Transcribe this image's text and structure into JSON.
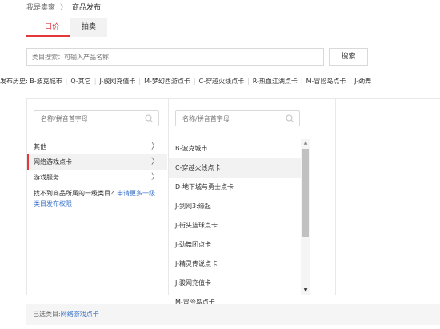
{
  "breadcrumb": {
    "root": "我是卖家",
    "separator": "〉",
    "current": "商品发布"
  },
  "tabs": [
    {
      "label": "一口价",
      "active": true
    },
    {
      "label": "拍卖",
      "active": false
    }
  ],
  "search": {
    "placeholder": "类目搜索：可输入产品名称",
    "button_label": "搜索"
  },
  "history": {
    "label": "发布历史:",
    "items": [
      "B-波克城市",
      "Q-其它",
      "J-骏网充值卡",
      "M-梦幻西游点卡",
      "C-穿越火线点卡",
      "R-热血江湖点卡",
      "M-冒险岛点卡",
      "J-劲舞"
    ]
  },
  "column1": {
    "filter_placeholder": "名称/拼音首字母",
    "items": [
      {
        "label": "其他",
        "chevron": "〉",
        "selected": false
      },
      {
        "label": "网络游戏点卡",
        "chevron": "〉",
        "selected": true
      },
      {
        "label": "游戏服务",
        "chevron": "〉",
        "selected": false
      }
    ],
    "note_text": "找不到商品所属的一级类目？",
    "note_link": "申请更多一级类目发布权限"
  },
  "column2": {
    "filter_placeholder": "名称/拼音首字母",
    "items": [
      {
        "label": "B-波克城市",
        "hover": false
      },
      {
        "label": "C-穿越火线点卡",
        "hover": true
      },
      {
        "label": "D-地下城与勇士点卡",
        "hover": false
      },
      {
        "label": "J-剑网3:缘起",
        "hover": false
      },
      {
        "label": "J-街头篮球点卡",
        "hover": false
      },
      {
        "label": "J-劲舞团点卡",
        "hover": false
      },
      {
        "label": "J-精灵传说点卡",
        "hover": false
      },
      {
        "label": "J-骏网充值卡",
        "hover": false
      },
      {
        "label": "M-冒险岛点卡",
        "hover": false
      }
    ],
    "scroll_up": "▲",
    "scroll_down": "▼"
  },
  "selected": {
    "label": "已选类目:",
    "value": "网络游戏点卡"
  },
  "icons": {
    "filter": "magnifier-icon"
  },
  "colors": {
    "accent": "#e4393c",
    "link": "#3b73c8",
    "selected_bg": "#f2f2f2",
    "footer_bg": "#f5f5f5"
  }
}
